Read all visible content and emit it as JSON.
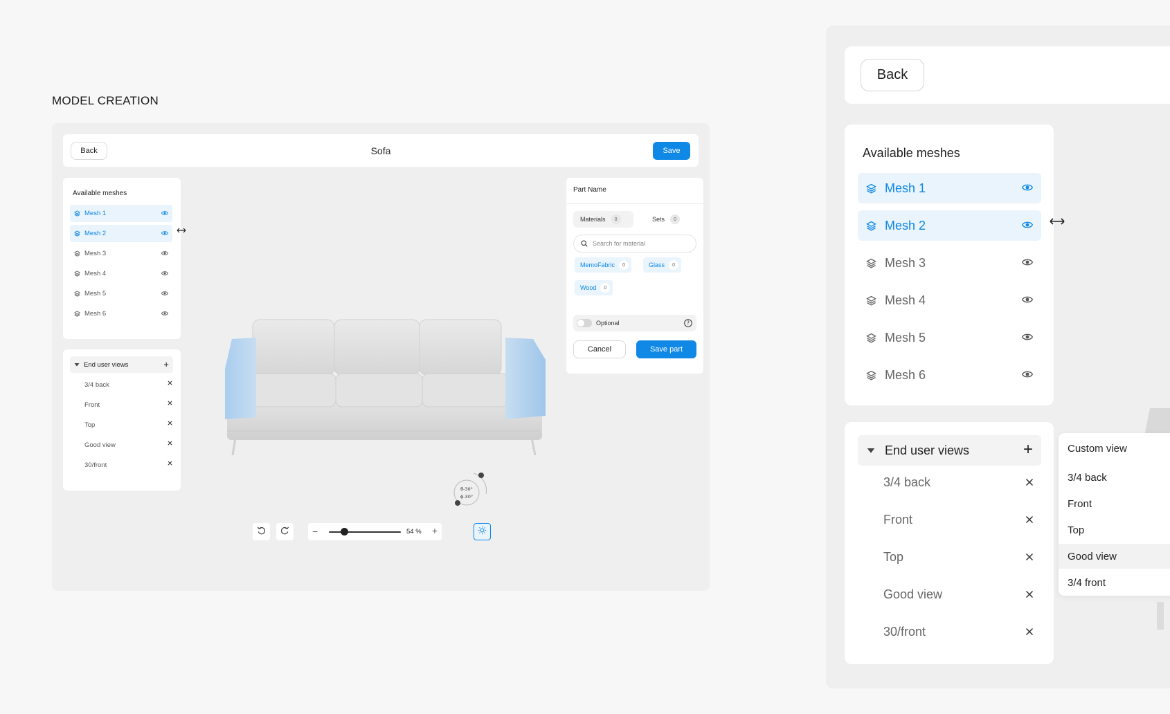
{
  "heading": "MODEL CREATION",
  "editor": {
    "back_label": "Back",
    "title": "Sofa",
    "save_label": "Save",
    "meshes_title": "Available meshes",
    "meshes": [
      {
        "label": "Mesh 1",
        "active": true
      },
      {
        "label": "Mesh 2",
        "active": true
      },
      {
        "label": "Mesh 3",
        "active": false
      },
      {
        "label": "Mesh 4",
        "active": false
      },
      {
        "label": "Mesh 5",
        "active": false
      },
      {
        "label": "Mesh 6",
        "active": false
      }
    ],
    "views_title": "End user views",
    "views": [
      "3/4 back",
      "Front",
      "Top",
      "Good view",
      "30/front"
    ],
    "part": {
      "title": "Part Name",
      "tab_materials": "Materials",
      "tab_materials_count": "0",
      "tab_sets": "Sets",
      "tab_sets_count": "0",
      "search_placeholder": "Search for material",
      "chips": [
        {
          "label": "MemoFabric",
          "count": "0"
        },
        {
          "label": "Glass",
          "count": "0"
        },
        {
          "label": "Wood",
          "count": "0"
        }
      ],
      "optional_label": "Optional",
      "cancel_label": "Cancel",
      "save_part_label": "Save part"
    },
    "orbit": {
      "theta": "θ-30°",
      "phi": "ϕ-30°"
    },
    "zoom": {
      "value": 54,
      "label": "54 %"
    },
    "colors": {
      "accent": "#0f88e6",
      "accent_light": "#eaf4fd"
    },
    "icons": [
      "undo-icon",
      "redo-icon",
      "sun-icon",
      "layers-icon",
      "eye-icon",
      "search-icon",
      "help-icon"
    ]
  },
  "zoomed": {
    "back_label": "Back",
    "meshes_title": "Available meshes",
    "meshes": [
      {
        "label": "Mesh 1",
        "active": true
      },
      {
        "label": "Mesh 2",
        "active": true
      },
      {
        "label": "Mesh 3",
        "active": false
      },
      {
        "label": "Mesh 4",
        "active": false
      },
      {
        "label": "Mesh 5",
        "active": false
      },
      {
        "label": "Mesh 6",
        "active": false
      }
    ],
    "views_title": "End user views",
    "views": [
      "3/4 back",
      "Front",
      "Top",
      "Good view",
      "30/front"
    ],
    "dropdown": [
      "Custom view",
      "3/4 back",
      "Front",
      "Top",
      "Good view",
      "3/4 front"
    ],
    "dropdown_highlighted": "Good view"
  }
}
